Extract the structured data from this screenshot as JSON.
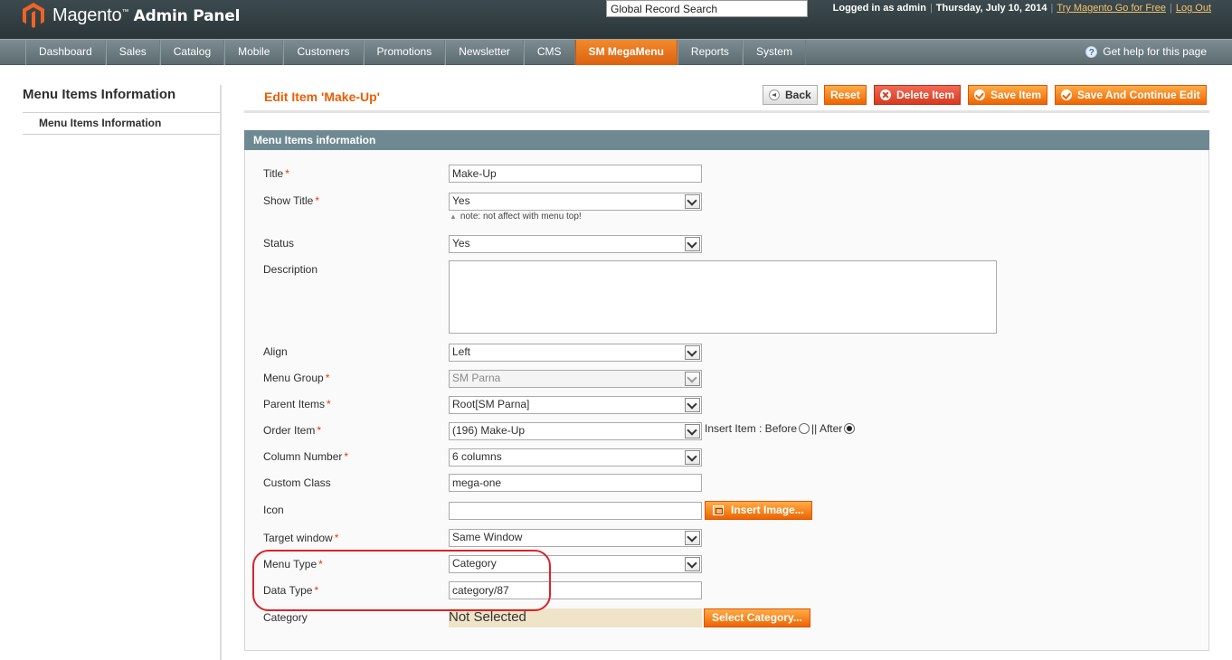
{
  "header": {
    "brand": "Magento",
    "brand_suffix": "Admin Panel",
    "global_search": "Global Record Search",
    "logged_in": "Logged in as admin",
    "date": "Thursday, July 10, 2014",
    "try_link": "Try Magento Go for Free",
    "logout_link": "Log Out"
  },
  "nav": {
    "items": [
      "Dashboard",
      "Sales",
      "Catalog",
      "Mobile",
      "Customers",
      "Promotions",
      "Newsletter",
      "CMS",
      "SM MegaMenu",
      "Reports",
      "System"
    ],
    "active": "SM MegaMenu",
    "help": "Get help for this page"
  },
  "sidebar": {
    "title": "Menu Items Information",
    "tab": "Menu Items Information"
  },
  "page": {
    "title": "Edit Item 'Make-Up'",
    "buttons": {
      "back": "Back",
      "reset": "Reset",
      "delete": "Delete Item",
      "save": "Save Item",
      "save_continue": "Save And Continue Edit"
    }
  },
  "form": {
    "section_title": "Menu Items information",
    "title_label": "Title",
    "title_value": "Make-Up",
    "show_title_label": "Show Title",
    "show_title_value": "Yes",
    "show_title_note": "note: not affect with menu top!",
    "status_label": "Status",
    "status_value": "Yes",
    "description_label": "Description",
    "description_value": "",
    "align_label": "Align",
    "align_value": "Left",
    "menu_group_label": "Menu Group",
    "menu_group_value": "SM Parna",
    "parent_items_label": "Parent Items",
    "parent_items_value": "Root[SM Parna]",
    "order_item_label": "Order Item",
    "order_item_value": "(196) Make-Up",
    "insert_item_label": "Insert Item : Before",
    "insert_item_after": "|| After",
    "insert_item_selected": "After",
    "column_number_label": "Column Number",
    "column_number_value": "6 columns",
    "custom_class_label": "Custom Class",
    "custom_class_value": "mega-one",
    "icon_label": "Icon",
    "icon_value": "",
    "insert_image_button": "Insert Image...",
    "target_window_label": "Target window",
    "target_window_value": "Same Window",
    "menu_type_label": "Menu Type",
    "menu_type_value": "Category",
    "data_type_label": "Data Type",
    "data_type_value": "category/87",
    "category_label": "Category",
    "category_value": "Not Selected",
    "select_category_button": "Select Category...",
    "required_mark": "*"
  },
  "colors": {
    "accent": "#eb5e00",
    "header_bg": "#2a3538",
    "section_head": "#6f8992",
    "highlight": "#d9242b"
  }
}
